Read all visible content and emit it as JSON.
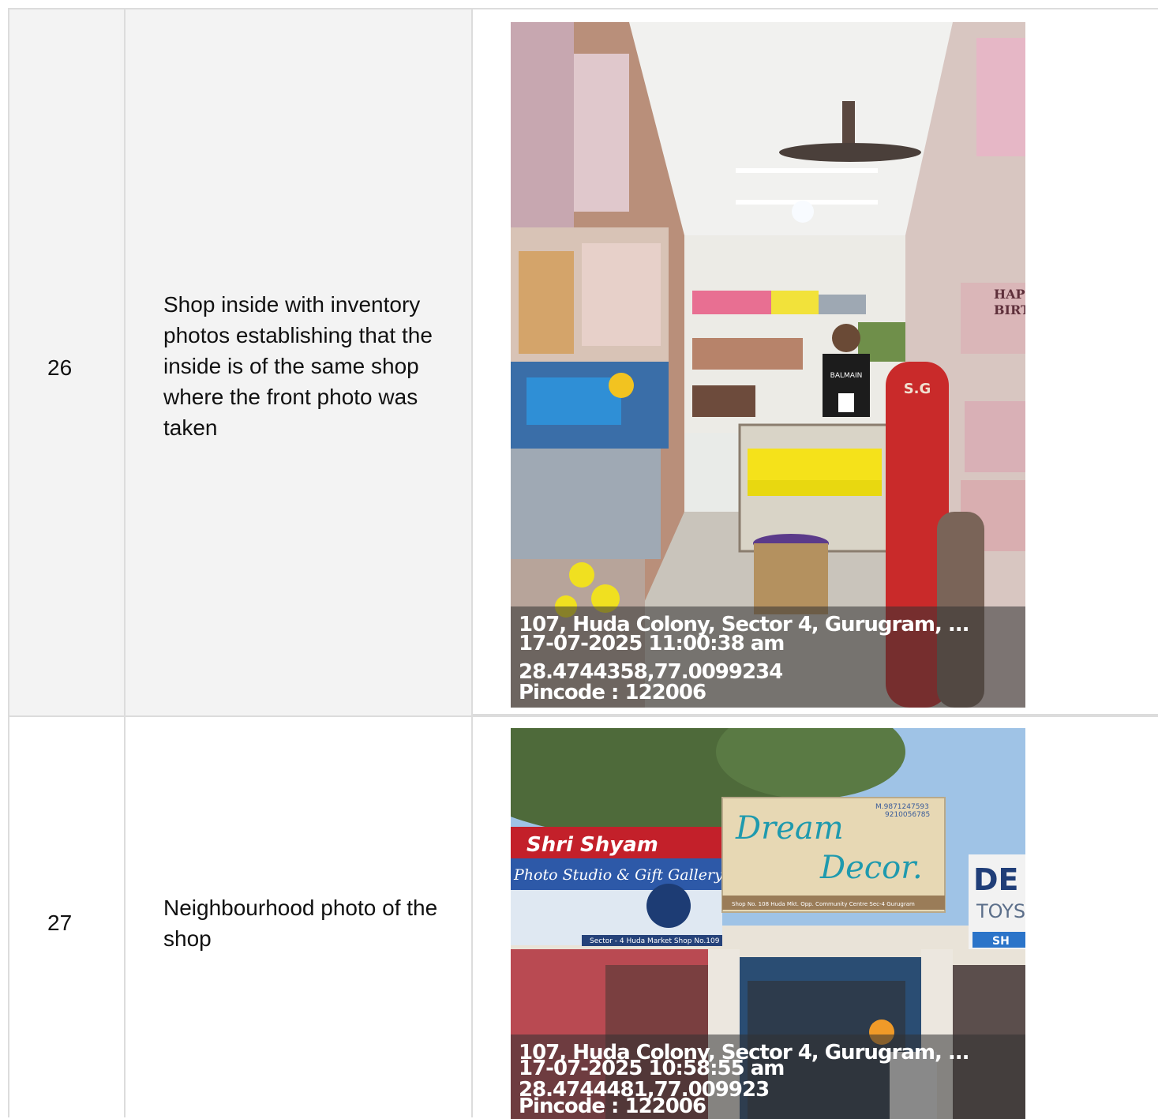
{
  "rows": [
    {
      "number": "26",
      "description": "Shop inside with inventory photos establishing that the inside is of the same shop where the front photo was taken",
      "photo": {
        "icon": "shop-interior-photo",
        "stamp": {
          "address": "107, Huda Colony, Sector 4, Gurugram, ...",
          "datetime": "17-07-2025 11:00:38 am",
          "coords": "28.4744358,77.0099234",
          "pincode": "Pincode : 122006"
        },
        "visible_text": {
          "tshirt": "BALMAIN",
          "cylinder": "S.G",
          "cards": [
            "HAPPY",
            "BIRTHDAY"
          ]
        }
      }
    },
    {
      "number": "27",
      "description": "Neighbourhood photo of the shop",
      "photo": {
        "icon": "shop-neighbourhood-photo",
        "stamp": {
          "address": "107, Huda Colony, Sector 4, Gurugram, ...",
          "datetime": "17-07-2025 10:58:55 am",
          "coords": "28.4744481,77.009923",
          "pincode": "Pincode : 122006"
        },
        "signs": {
          "left_title": "Shri Shyam",
          "left_subtitle": "Photo Studio & Gift Gallery",
          "left_address": "Sector - 4 Huda Market Shop No.109",
          "center_line1": "Dream",
          "center_line2": "Decor.",
          "center_phones": [
            "M.9871247593",
            "9210056785"
          ],
          "center_address": "Shop No. 108 Huda Mkt. Opp. Community Centre Sec-4 Gurugram",
          "right_title": "DE",
          "right_sub": "TOYS",
          "right_band": "SH"
        }
      }
    }
  ]
}
